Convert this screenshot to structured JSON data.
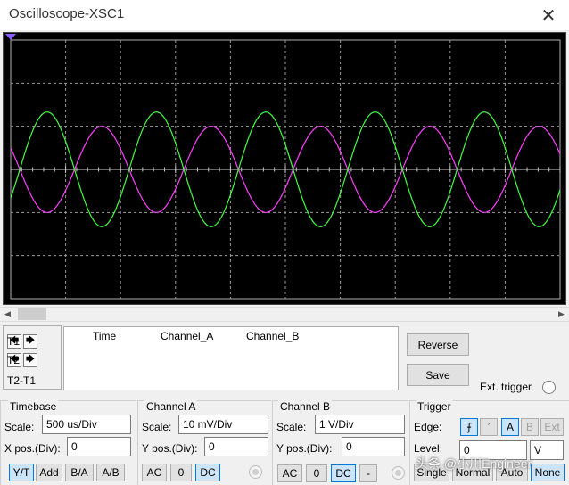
{
  "window": {
    "title": "Oscilloscope-XSC1",
    "close_glyph": "✕"
  },
  "colors": {
    "channel_a": "#ff40ff",
    "channel_b": "#40ff40",
    "screen": "#000000",
    "grid": "#9a9a9a"
  },
  "chart_data": {
    "type": "line",
    "x": {
      "divisions": 10,
      "scale": "500 us/Div"
    },
    "y": {
      "divisions": 6,
      "range": [
        -3,
        3
      ]
    },
    "grid": true,
    "series": [
      {
        "name": "Channel_A",
        "color": "#ff40ff",
        "amplitude_div": 1.0,
        "period_div": 1.99,
        "phase_deg": 150
      },
      {
        "name": "Channel_B",
        "color": "#40ff40",
        "amplitude_div": 1.33,
        "period_div": 1.99,
        "phase_deg": -30
      }
    ]
  },
  "cursors": {
    "t1": "T1",
    "t2": "T2",
    "diff": "T2-T1",
    "left_glyph": "🡄",
    "right_glyph": "🡆"
  },
  "readout": {
    "headers": [
      "Time",
      "Channel_A",
      "Channel_B"
    ]
  },
  "buttons": {
    "reverse": "Reverse",
    "save": "Save",
    "ext_trigger": "Ext. trigger"
  },
  "timebase": {
    "title": "Timebase",
    "scale_label": "Scale:",
    "scale_value": "500 us/Div",
    "xpos_label": "X pos.(Div):",
    "xpos_value": "0",
    "modes": [
      "Y/T",
      "Add",
      "B/A",
      "A/B"
    ]
  },
  "channel_a": {
    "title": "Channel A",
    "scale_label": "Scale:",
    "scale_value": "10 mV/Div",
    "ypos_label": "Y pos.(Div):",
    "ypos_value": "0",
    "coupling": [
      "AC",
      "0",
      "DC"
    ]
  },
  "channel_b": {
    "title": "Channel B",
    "scale_label": "Scale:",
    "scale_value": "1  V/Div",
    "ypos_label": "Y pos.(Div):",
    "ypos_value": "0",
    "coupling": [
      "AC",
      "0",
      "DC",
      "-"
    ]
  },
  "trigger": {
    "title": "Trigger",
    "edge_label": "Edge:",
    "rise_glyph": "⨍",
    "fall_glyph": "ʾ",
    "sources": [
      "A",
      "B",
      "Ext"
    ],
    "level_label": "Level:",
    "level_value": "0",
    "level_unit": "V",
    "modes": [
      "Single",
      "Normal",
      "Auto",
      "None"
    ]
  },
  "watermark": "头条 @小川Engineer"
}
